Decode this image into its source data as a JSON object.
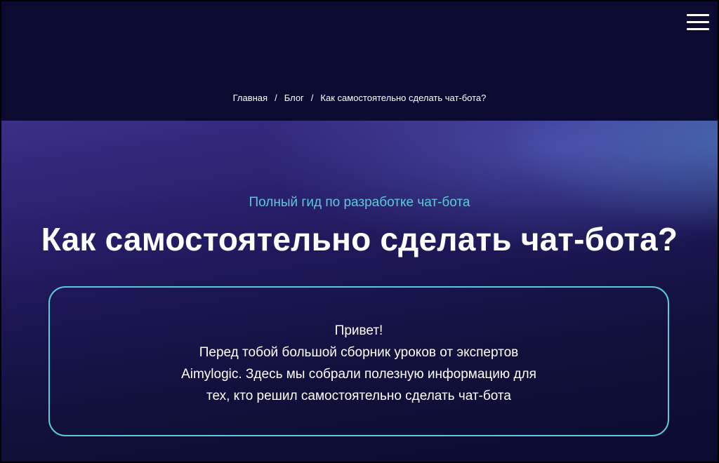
{
  "breadcrumb": {
    "items": [
      "Главная",
      "Блог",
      "Как самостоятельно сделать чат-бота?"
    ],
    "separator": "/"
  },
  "hero": {
    "subtitle": "Полный гид по разработке чат-бота",
    "title": "Как самостоятельно сделать чат-бота?"
  },
  "intro": {
    "lines": [
      "Привет!",
      "Перед тобой большой сборник уроков от экспертов",
      "Aimylogic. Здесь мы собрали полезную информацию для",
      "тех, кто решил самостоятельно сделать чат-бота"
    ]
  },
  "icons": {
    "menu": "hamburger-menu-icon"
  },
  "colors": {
    "header_bg": "#0b0b31",
    "accent": "#5ec9d6",
    "text": "#ffffff"
  }
}
